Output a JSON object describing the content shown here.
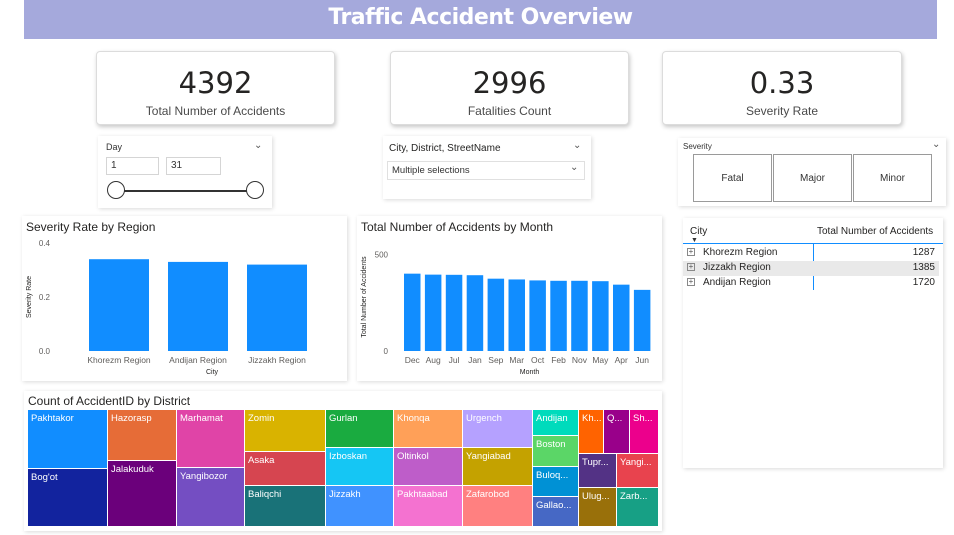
{
  "title": "Traffic Accident Overview",
  "kpis": [
    {
      "value": "4392",
      "label": "Total Number of Accidents"
    },
    {
      "value": "2996",
      "label": "Fatalities Count"
    },
    {
      "value": "0.33",
      "label": "Severity Rate"
    }
  ],
  "day_slicer": {
    "title": "Day",
    "from": "1",
    "to": "31"
  },
  "location_slicer": {
    "title": "City, District, StreetName",
    "value": "Multiple selections"
  },
  "severity_slicer": {
    "title": "Severity",
    "options": [
      "Fatal",
      "Major",
      "Minor"
    ]
  },
  "table": {
    "headers": [
      "City",
      "Total Number of Accidents"
    ],
    "rows": [
      {
        "city": "Khorezm Region",
        "total": "1287"
      },
      {
        "city": "Jizzakh Region",
        "total": "1385"
      },
      {
        "city": "Andijan Region",
        "total": "1720"
      }
    ]
  },
  "chart_data": [
    {
      "type": "bar",
      "title": "Severity Rate by Region",
      "xlabel": "City",
      "ylabel": "Severity Rate",
      "categories": [
        "Khorezm Region",
        "Andijan Region",
        "Jizzakh Region"
      ],
      "values": [
        0.34,
        0.33,
        0.32
      ],
      "yticks": [
        "0.0",
        "0.2",
        "0.4"
      ],
      "ylim": [
        0,
        0.4
      ],
      "color": "#118dff"
    },
    {
      "type": "bar",
      "title": "Total Number of Accidents by Month",
      "xlabel": "Month",
      "ylabel": "Total Number of Accidents",
      "categories": [
        "Dec",
        "Aug",
        "Jul",
        "Jan",
        "Sep",
        "Mar",
        "Oct",
        "Feb",
        "Nov",
        "May",
        "Apr",
        "Jun"
      ],
      "values": [
        401,
        396,
        395,
        393,
        375,
        371,
        366,
        364,
        364,
        362,
        344,
        317
      ],
      "yticks": [
        "0",
        "500"
      ],
      "ylim": [
        0,
        560
      ],
      "color": "#118dff"
    },
    {
      "type": "treemap",
      "title": "Count of AccidentID by District",
      "cells": [
        {
          "label": "Pakhtakor",
          "color": "#118dff"
        },
        {
          "label": "Bog'ot",
          "color": "#12239e"
        },
        {
          "label": "Hazorasp",
          "color": "#e66c37"
        },
        {
          "label": "Jalakuduk",
          "color": "#6b007b"
        },
        {
          "label": "Marhamat",
          "color": "#e044a7"
        },
        {
          "label": "Yangibozor",
          "color": "#744ec2"
        },
        {
          "label": "Zomin",
          "color": "#d9b300"
        },
        {
          "label": "Asaka",
          "color": "#d64550"
        },
        {
          "label": "Baliqchi",
          "color": "#197278"
        },
        {
          "label": "Gurlan",
          "color": "#1aab40"
        },
        {
          "label": "Izboskan",
          "color": "#15c6f4"
        },
        {
          "label": "Jizzakh",
          "color": "#4092ff"
        },
        {
          "label": "Khonqa",
          "color": "#ffa058"
        },
        {
          "label": "Oltinkol",
          "color": "#be5dc9"
        },
        {
          "label": "Pakhtaabad",
          "color": "#f472d0"
        },
        {
          "label": "Urgench",
          "color": "#b5a1ff"
        },
        {
          "label": "Yangiabad",
          "color": "#c4a200"
        },
        {
          "label": "Zafarobod",
          "color": "#ff8080"
        },
        {
          "label": "Andijan",
          "color": "#00dbbc"
        },
        {
          "label": "Boston",
          "color": "#5bd667"
        },
        {
          "label": "Buloq...",
          "color": "#0091d5"
        },
        {
          "label": "Gallao...",
          "color": "#4668c5"
        },
        {
          "label": "Kh...",
          "color": "#ff6300"
        },
        {
          "label": "Q...",
          "color": "#99008a"
        },
        {
          "label": "Sh...",
          "color": "#ec008c"
        },
        {
          "label": "Tupr...",
          "color": "#533285"
        },
        {
          "label": "Yangi...",
          "color": "#e8434e"
        },
        {
          "label": "Ulug...",
          "color": "#99700a"
        },
        {
          "label": "Zarb...",
          "color": "#17a085"
        }
      ]
    }
  ]
}
